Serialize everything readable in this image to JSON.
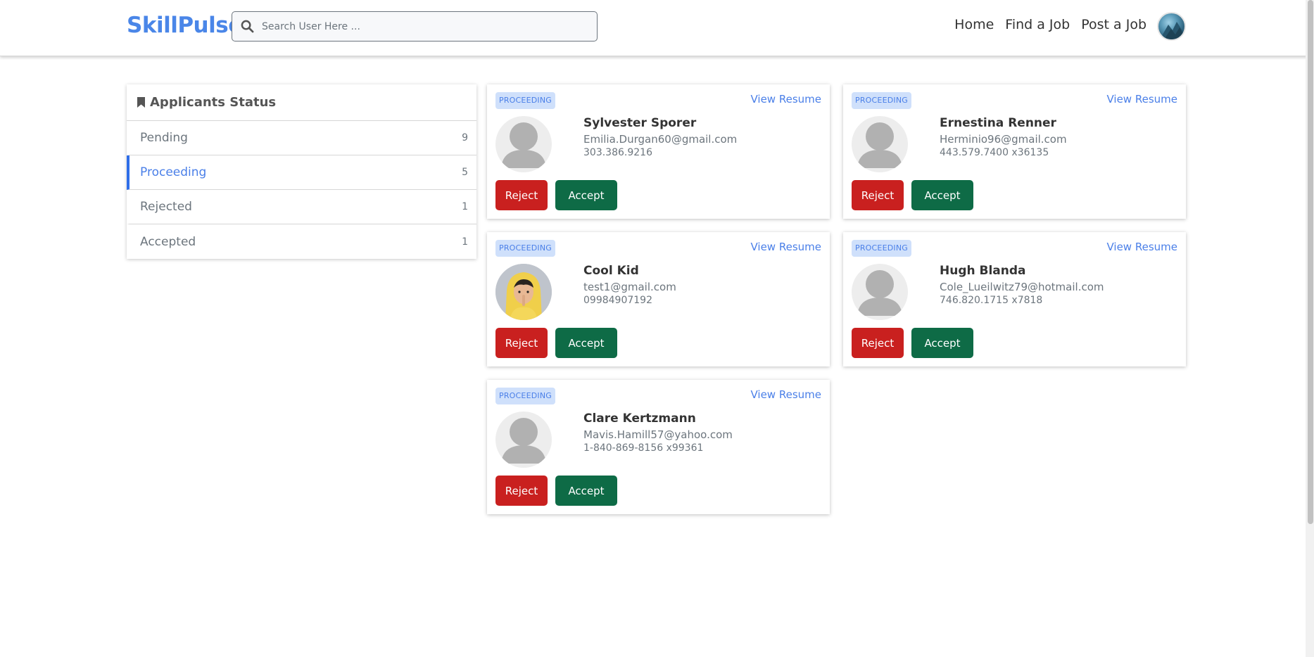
{
  "header": {
    "brand": "SkillPulse",
    "search_placeholder": "Search User Here ...",
    "nav": [
      "Home",
      "Find a Job",
      "Post a Job"
    ]
  },
  "sidebar": {
    "title": "Applicants Status",
    "items": [
      {
        "label": "Pending",
        "count": "9",
        "active": false
      },
      {
        "label": "Proceeding",
        "count": "5",
        "active": true
      },
      {
        "label": "Rejected",
        "count": "1",
        "active": false
      },
      {
        "label": "Accepted",
        "count": "1",
        "active": false
      }
    ]
  },
  "applicants": [
    {
      "status": "PROCEEDING",
      "view": "View Resume",
      "name": "Sylvester Sporer",
      "email": "Emilia.Durgan60@gmail.com",
      "phone": "303.386.9216",
      "avatar": "default-avatar",
      "reject": "Reject",
      "accept": "Accept"
    },
    {
      "status": "PROCEEDING",
      "view": "View Resume",
      "name": "Ernestina Renner",
      "email": "Herminio96@gmail.com",
      "phone": "443.579.7400 x36135",
      "avatar": "default-avatar",
      "reject": "Reject",
      "accept": "Accept"
    },
    {
      "status": "PROCEEDING",
      "view": "View Resume",
      "name": "Cool Kid",
      "email": "test1@gmail.com",
      "phone": "09984907192",
      "avatar": "photo-avatar",
      "reject": "Reject",
      "accept": "Accept"
    },
    {
      "status": "PROCEEDING",
      "view": "View Resume",
      "name": "Hugh Blanda",
      "email": "Cole_Lueilwitz79@hotmail.com",
      "phone": "746.820.1715 x7818",
      "avatar": "default-avatar",
      "reject": "Reject",
      "accept": "Accept"
    },
    {
      "status": "PROCEEDING",
      "view": "View Resume",
      "name": "Clare Kertzmann",
      "email": "Mavis.Hamill57@yahoo.com",
      "phone": "1-840-869-8156 x99361",
      "avatar": "default-avatar",
      "reject": "Reject",
      "accept": "Accept"
    }
  ],
  "colors": {
    "brand": "#4a86e8",
    "reject": "#c9201f",
    "accept": "#0e6b46",
    "badge_bg": "#cfe0fb",
    "link": "#4a7fe8"
  }
}
